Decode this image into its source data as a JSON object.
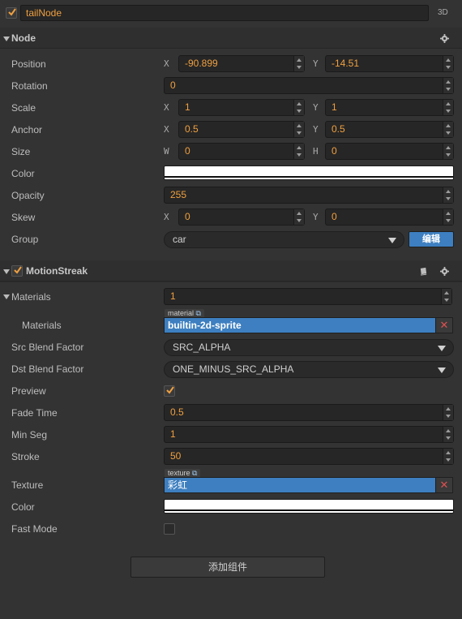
{
  "node": {
    "enabled": true,
    "name": "tailNode",
    "mode_badge": "3D"
  },
  "node_section": {
    "title": "Node",
    "position": {
      "label": "Position",
      "x_axis": "X",
      "x": "-90.899",
      "y_axis": "Y",
      "y": "-14.51"
    },
    "rotation": {
      "label": "Rotation",
      "value": "0"
    },
    "scale": {
      "label": "Scale",
      "x_axis": "X",
      "x": "1",
      "y_axis": "Y",
      "y": "1"
    },
    "anchor": {
      "label": "Anchor",
      "x_axis": "X",
      "x": "0.5",
      "y_axis": "Y",
      "y": "0.5"
    },
    "size": {
      "label": "Size",
      "w_axis": "W",
      "w": "0",
      "h_axis": "H",
      "h": "0"
    },
    "color": {
      "label": "Color",
      "value": "#ffffff"
    },
    "opacity": {
      "label": "Opacity",
      "value": "255"
    },
    "skew": {
      "label": "Skew",
      "x_axis": "X",
      "x": "0",
      "y_axis": "Y",
      "y": "0"
    },
    "group": {
      "label": "Group",
      "value": "car",
      "edit_button": "编辑"
    }
  },
  "motion_streak": {
    "enabled": true,
    "title": "MotionStreak",
    "materials_header": {
      "label": "Materials",
      "count": "1"
    },
    "material_item": {
      "label": "Materials",
      "tag": "material",
      "value": "builtin-2d-sprite"
    },
    "src_blend": {
      "label": "Src Blend Factor",
      "value": "SRC_ALPHA"
    },
    "dst_blend": {
      "label": "Dst Blend Factor",
      "value": "ONE_MINUS_SRC_ALPHA"
    },
    "preview": {
      "label": "Preview",
      "checked": true
    },
    "fade_time": {
      "label": "Fade Time",
      "value": "0.5"
    },
    "min_seg": {
      "label": "Min Seg",
      "value": "1"
    },
    "stroke": {
      "label": "Stroke",
      "value": "50"
    },
    "texture": {
      "label": "Texture",
      "tag": "texture",
      "value": "彩虹"
    },
    "color": {
      "label": "Color",
      "value": "#ffffff"
    },
    "fast_mode": {
      "label": "Fast Mode",
      "checked": false
    }
  },
  "add_component_button": "添加组件",
  "colors": {
    "accent": "#f0a040",
    "asset_blue": "#3d7fc0",
    "background": "#333333"
  }
}
